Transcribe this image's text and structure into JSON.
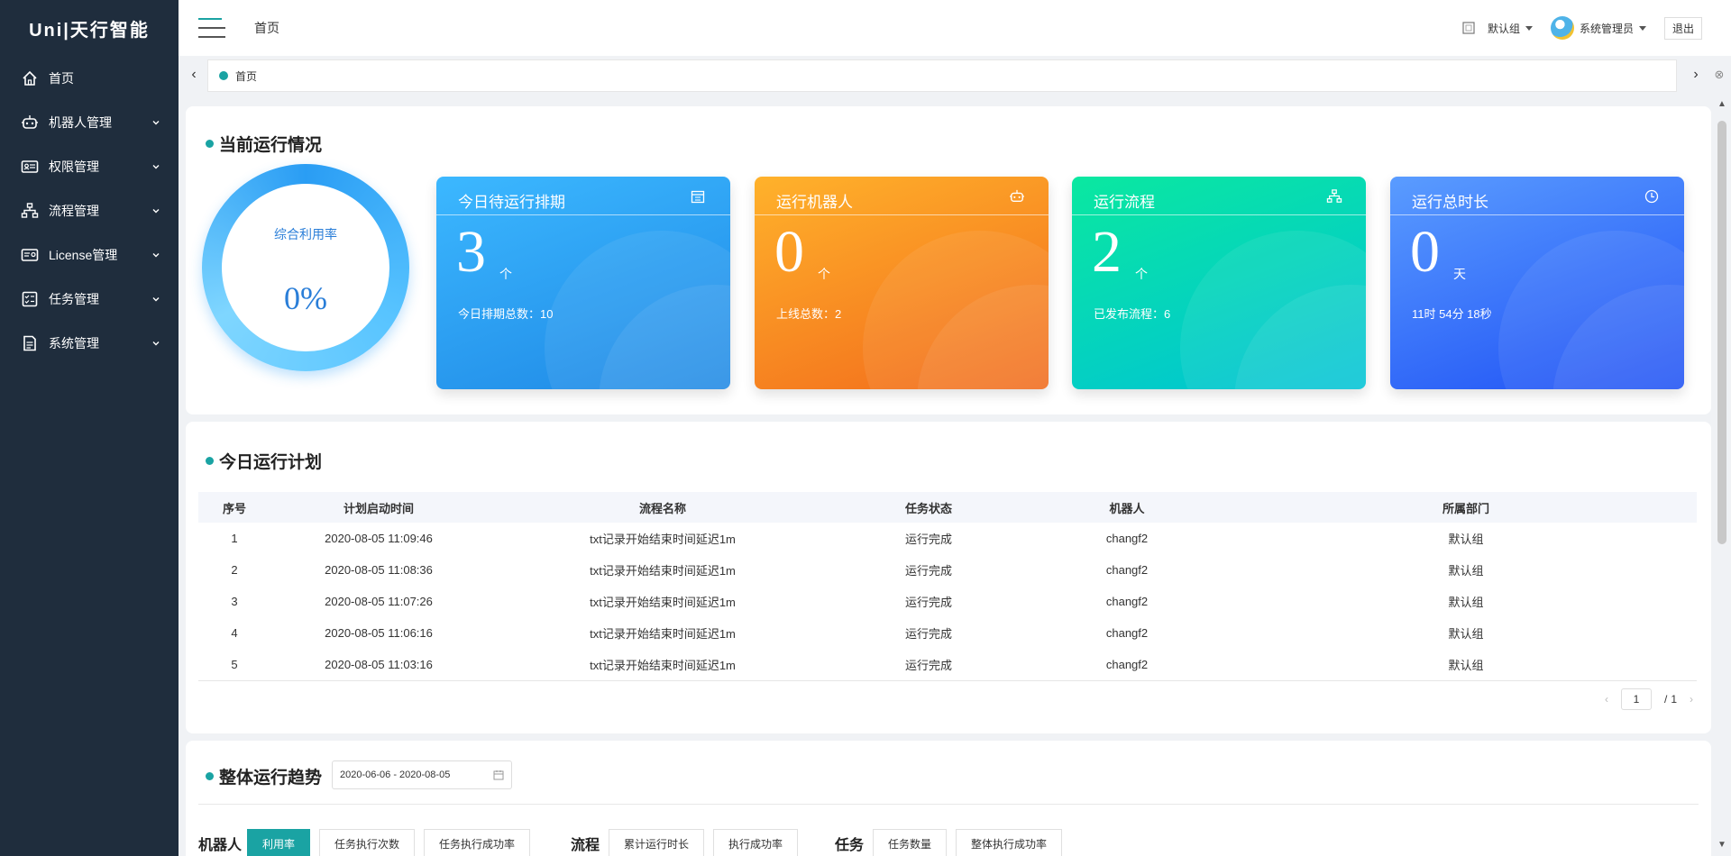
{
  "app": {
    "brand": "Uni|天行智能"
  },
  "sidebar": {
    "items": [
      {
        "label": "首页",
        "icon": "home-icon"
      },
      {
        "label": "机器人管理",
        "icon": "robot-icon"
      },
      {
        "label": "权限管理",
        "icon": "id-card-icon"
      },
      {
        "label": "流程管理",
        "icon": "flow-icon"
      },
      {
        "label": "License管理",
        "icon": "license-icon"
      },
      {
        "label": "任务管理",
        "icon": "task-icon"
      },
      {
        "label": "系统管理",
        "icon": "document-icon"
      }
    ]
  },
  "header": {
    "breadcrumb": "首页",
    "group": "默认组",
    "user": "系统管理员",
    "logout": "退出"
  },
  "tabs": [
    {
      "label": "首页"
    }
  ],
  "overview": {
    "title": "当前运行情况",
    "ring": {
      "caption": "综合利用率",
      "value": "0%"
    },
    "cards": [
      {
        "title": "今日待运行排期",
        "value": "3",
        "unit": "个",
        "sub": "今日排期总数：10",
        "icon": "calendar-icon",
        "color_from": "#3cb8ff",
        "color_to": "#1e88e5"
      },
      {
        "title": "运行机器人",
        "value": "0",
        "unit": "个",
        "sub": "上线总数：2",
        "icon": "robot-icon",
        "color_from": "#ffb22b",
        "color_to": "#f26a1b"
      },
      {
        "title": "运行流程",
        "value": "2",
        "unit": "个",
        "sub": "已发布流程：6",
        "icon": "flow-icon",
        "color_from": "#0ae8a0",
        "color_to": "#00c2d6"
      },
      {
        "title": "运行总时长",
        "value": "0",
        "unit": "天",
        "sub": "11时 54分 18秒",
        "icon": "clock-icon",
        "color_from": "#5a9cff",
        "color_to": "#1e50f5"
      }
    ]
  },
  "plan": {
    "title": "今日运行计划",
    "columns": [
      "序号",
      "计划启动时间",
      "流程名称",
      "任务状态",
      "机器人",
      "所属部门"
    ],
    "rows": [
      [
        "1",
        "2020-08-05 11:09:46",
        "txt记录开始结束时间延迟1m",
        "运行完成",
        "changf2",
        "默认组"
      ],
      [
        "2",
        "2020-08-05 11:08:36",
        "txt记录开始结束时间延迟1m",
        "运行完成",
        "changf2",
        "默认组"
      ],
      [
        "3",
        "2020-08-05 11:07:26",
        "txt记录开始结束时间延迟1m",
        "运行完成",
        "changf2",
        "默认组"
      ],
      [
        "4",
        "2020-08-05 11:06:16",
        "txt记录开始结束时间延迟1m",
        "运行完成",
        "changf2",
        "默认组"
      ],
      [
        "5",
        "2020-08-05 11:03:16",
        "txt记录开始结束时间延迟1m",
        "运行完成",
        "changf2",
        "默认组"
      ]
    ],
    "pager": {
      "current": "1",
      "sep": "/",
      "total": "1"
    }
  },
  "trend": {
    "title": "整体运行趋势",
    "date_range": "2020-06-06 - 2020-08-05",
    "groups": [
      {
        "label": "机器人",
        "buttons": [
          "利用率",
          "任务执行次数",
          "任务执行成功率"
        ],
        "active": 0
      },
      {
        "label": "流程",
        "buttons": [
          "累计运行时长",
          "执行成功率"
        ],
        "active": -1
      },
      {
        "label": "任务",
        "buttons": [
          "任务数量",
          "整体执行成功率"
        ],
        "active": -1
      }
    ]
  },
  "colors": {
    "accent": "#1aa3a3",
    "sidebar": "#1f2d3d"
  }
}
